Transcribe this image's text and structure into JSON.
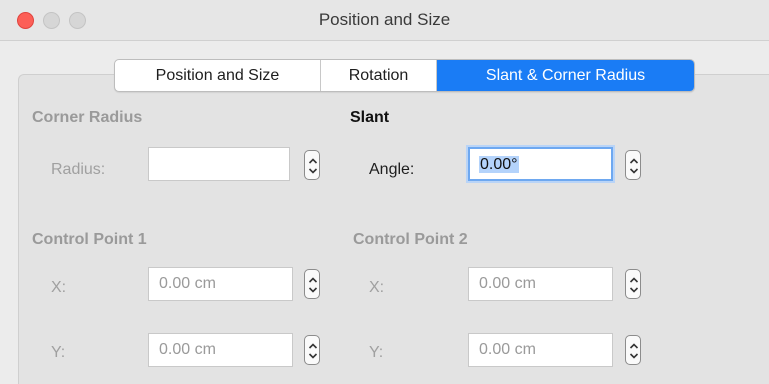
{
  "window": {
    "title": "Position and Size"
  },
  "tabs": [
    {
      "label": "Position and Size"
    },
    {
      "label": "Rotation"
    },
    {
      "label": "Slant & Corner Radius"
    }
  ],
  "corner_radius": {
    "heading": "Corner Radius",
    "radius_label": "Radius:",
    "radius_value": ""
  },
  "slant": {
    "heading": "Slant",
    "angle_label": "Angle:",
    "angle_value": "0.00°"
  },
  "control_point_1": {
    "heading": "Control Point 1",
    "x_label": "X:",
    "x_value": "0.00 cm",
    "y_label": "Y:",
    "y_value": "0.00 cm"
  },
  "control_point_2": {
    "heading": "Control Point 2",
    "x_label": "X:",
    "x_value": "0.00 cm",
    "y_label": "Y:",
    "y_value": "0.00 cm"
  },
  "colors": {
    "accent": "#1a7cf5",
    "close": "#fc5f57",
    "focus_ring": "#6ea8f0"
  },
  "icons": {
    "close": "close-icon",
    "minimize": "minimize-icon",
    "zoom": "zoom-icon",
    "stepper": "up-down-stepper-icon"
  }
}
